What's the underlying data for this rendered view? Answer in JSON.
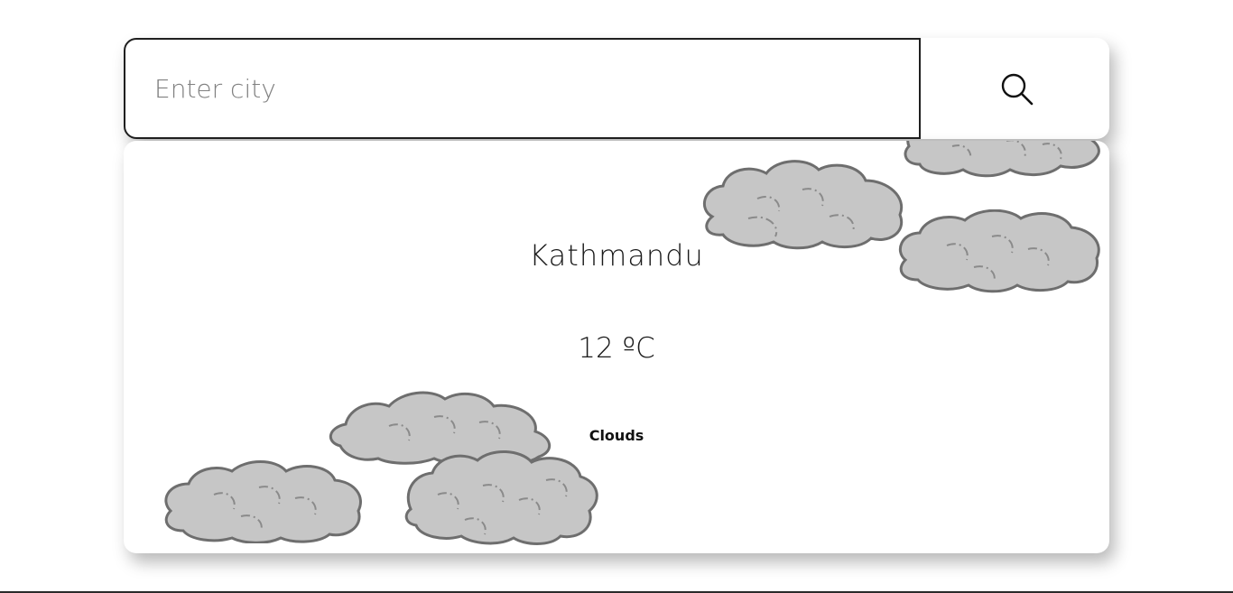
{
  "search": {
    "placeholder": "Enter city",
    "value": ""
  },
  "weather": {
    "city": "Kathmandu",
    "temperature": "12 ºC",
    "condition": "Clouds"
  },
  "icons": {
    "search_button": "search-icon",
    "background": "cloud-icon"
  },
  "colors": {
    "cloud_fill": "#c6c6c6",
    "cloud_stroke": "#6e6e6e",
    "text": "#1a1a1a"
  }
}
